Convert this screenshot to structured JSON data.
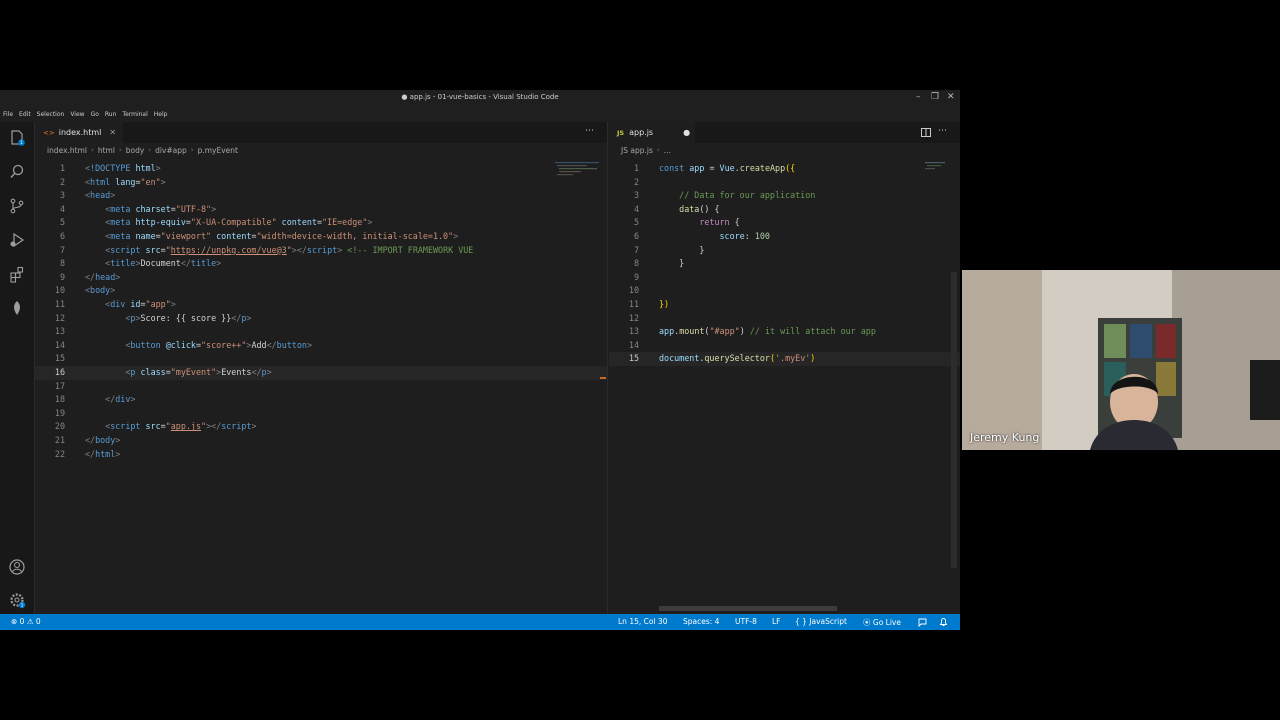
{
  "window": {
    "title": "● app.js - 01-vue-basics - Visual Studio Code",
    "controls": [
      "–",
      "❐",
      "✕"
    ]
  },
  "menu": [
    "File",
    "Edit",
    "Selection",
    "View",
    "Go",
    "Run",
    "Terminal",
    "Help"
  ],
  "activity_icons": [
    "explorer-icon",
    "search-icon",
    "source-control-icon",
    "run-debug-icon",
    "extensions-icon",
    "live-share-icon",
    "account-icon",
    "settings-gear-icon"
  ],
  "activity_badges": {
    "explorer": "1",
    "settings": "1"
  },
  "left_editor": {
    "tab": {
      "icon": "<>",
      "label": "index.html",
      "close": "✕"
    },
    "breadcrumb": [
      "index.html",
      "html",
      "body",
      "div#app",
      "p.myEvent"
    ],
    "active_line": 16,
    "lines": [
      {
        "n": "1",
        "parts": [
          [
            "t-pun",
            "<"
          ],
          [
            "t-tag",
            "!DOCTYPE "
          ],
          [
            "t-attr",
            "html"
          ],
          [
            "t-pun",
            ">"
          ]
        ]
      },
      {
        "n": "2",
        "parts": [
          [
            "t-pun",
            "<"
          ],
          [
            "t-tag",
            "html "
          ],
          [
            "t-attr",
            "lang"
          ],
          [
            "t-txt",
            "="
          ],
          [
            "t-str",
            "\"en\""
          ],
          [
            "t-pun",
            ">"
          ]
        ]
      },
      {
        "n": "3",
        "parts": [
          [
            "t-pun",
            "<"
          ],
          [
            "t-tag",
            "head"
          ],
          [
            "t-pun",
            ">"
          ]
        ]
      },
      {
        "n": "4",
        "parts": [
          [
            "t-txt",
            "    "
          ],
          [
            "t-pun",
            "<"
          ],
          [
            "t-tag",
            "meta "
          ],
          [
            "t-attr",
            "charset"
          ],
          [
            "t-txt",
            "="
          ],
          [
            "t-str",
            "\"UTF-8\""
          ],
          [
            "t-pun",
            ">"
          ]
        ]
      },
      {
        "n": "5",
        "parts": [
          [
            "t-txt",
            "    "
          ],
          [
            "t-pun",
            "<"
          ],
          [
            "t-tag",
            "meta "
          ],
          [
            "t-attr",
            "http-equiv"
          ],
          [
            "t-txt",
            "="
          ],
          [
            "t-str",
            "\"X-UA-Compatible\""
          ],
          [
            "t-txt",
            " "
          ],
          [
            "t-attr",
            "content"
          ],
          [
            "t-txt",
            "="
          ],
          [
            "t-str",
            "\"IE=edge\""
          ],
          [
            "t-pun",
            ">"
          ]
        ]
      },
      {
        "n": "6",
        "parts": [
          [
            "t-txt",
            "    "
          ],
          [
            "t-pun",
            "<"
          ],
          [
            "t-tag",
            "meta "
          ],
          [
            "t-attr",
            "name"
          ],
          [
            "t-txt",
            "="
          ],
          [
            "t-str",
            "\"viewport\""
          ],
          [
            "t-txt",
            " "
          ],
          [
            "t-attr",
            "content"
          ],
          [
            "t-txt",
            "="
          ],
          [
            "t-str",
            "\"width=device-width, initial-scale=1.0\""
          ],
          [
            "t-pun",
            ">"
          ]
        ]
      },
      {
        "n": "7",
        "parts": [
          [
            "t-txt",
            "    "
          ],
          [
            "t-pun",
            "<"
          ],
          [
            "t-tag",
            "script "
          ],
          [
            "t-attr",
            "src"
          ],
          [
            "t-txt",
            "="
          ],
          [
            "t-str",
            "\""
          ],
          [
            "t-url",
            "https://unpkg.com/vue@3"
          ],
          [
            "t-str",
            "\""
          ],
          [
            "t-pun",
            "></"
          ],
          [
            "t-tag",
            "script"
          ],
          [
            "t-pun",
            ">"
          ],
          [
            "t-txt",
            " "
          ],
          [
            "t-com",
            "<!-- IMPORT FRAMEWORK VUE"
          ]
        ]
      },
      {
        "n": "8",
        "parts": [
          [
            "t-txt",
            "    "
          ],
          [
            "t-pun",
            "<"
          ],
          [
            "t-tag",
            "title"
          ],
          [
            "t-pun",
            ">"
          ],
          [
            "t-txt",
            "Document"
          ],
          [
            "t-pun",
            "</"
          ],
          [
            "t-tag",
            "title"
          ],
          [
            "t-pun",
            ">"
          ]
        ]
      },
      {
        "n": "9",
        "parts": [
          [
            "t-pun",
            "</"
          ],
          [
            "t-tag",
            "head"
          ],
          [
            "t-pun",
            ">"
          ]
        ]
      },
      {
        "n": "10",
        "parts": [
          [
            "t-pun",
            "<"
          ],
          [
            "t-tag",
            "body"
          ],
          [
            "t-pun",
            ">"
          ]
        ]
      },
      {
        "n": "11",
        "parts": [
          [
            "t-txt",
            "    "
          ],
          [
            "t-pun",
            "<"
          ],
          [
            "t-tag",
            "div "
          ],
          [
            "t-attr",
            "id"
          ],
          [
            "t-txt",
            "="
          ],
          [
            "t-str",
            "\"app\""
          ],
          [
            "t-pun",
            ">"
          ]
        ]
      },
      {
        "n": "12",
        "parts": [
          [
            "t-txt",
            "        "
          ],
          [
            "t-pun",
            "<"
          ],
          [
            "t-tag",
            "p"
          ],
          [
            "t-pun",
            ">"
          ],
          [
            "t-txt",
            "Score: {{ score }}"
          ],
          [
            "t-pun",
            "</"
          ],
          [
            "t-tag",
            "p"
          ],
          [
            "t-pun",
            ">"
          ]
        ]
      },
      {
        "n": "13",
        "parts": []
      },
      {
        "n": "14",
        "parts": [
          [
            "t-txt",
            "        "
          ],
          [
            "t-pun",
            "<"
          ],
          [
            "t-tag",
            "button "
          ],
          [
            "t-attr",
            "@click"
          ],
          [
            "t-txt",
            "="
          ],
          [
            "t-str",
            "\"score++\""
          ],
          [
            "t-pun",
            ">"
          ],
          [
            "t-txt",
            "Add"
          ],
          [
            "t-pun",
            "</"
          ],
          [
            "t-tag",
            "button"
          ],
          [
            "t-pun",
            ">"
          ]
        ]
      },
      {
        "n": "15",
        "parts": []
      },
      {
        "n": "16",
        "parts": [
          [
            "t-txt",
            "        "
          ],
          [
            "t-pun",
            "<"
          ],
          [
            "t-tag",
            "p "
          ],
          [
            "t-attr",
            "class"
          ],
          [
            "t-txt",
            "="
          ],
          [
            "t-str",
            "\"myEvent\""
          ],
          [
            "t-pun",
            ">"
          ],
          [
            "t-txt",
            "Events"
          ],
          [
            "t-pun",
            "</"
          ],
          [
            "t-tag",
            "p"
          ],
          [
            "t-pun",
            ">"
          ]
        ]
      },
      {
        "n": "17",
        "parts": []
      },
      {
        "n": "18",
        "parts": [
          [
            "t-txt",
            "    "
          ],
          [
            "t-pun",
            "</"
          ],
          [
            "t-tag",
            "div"
          ],
          [
            "t-pun",
            ">"
          ]
        ]
      },
      {
        "n": "19",
        "parts": []
      },
      {
        "n": "20",
        "parts": [
          [
            "t-txt",
            "    "
          ],
          [
            "t-pun",
            "<"
          ],
          [
            "t-tag",
            "script "
          ],
          [
            "t-attr",
            "src"
          ],
          [
            "t-txt",
            "="
          ],
          [
            "t-str",
            "\""
          ],
          [
            "t-url",
            "app.js"
          ],
          [
            "t-str",
            "\""
          ],
          [
            "t-pun",
            "></"
          ],
          [
            "t-tag",
            "script"
          ],
          [
            "t-pun",
            ">"
          ]
        ]
      },
      {
        "n": "21",
        "parts": [
          [
            "t-pun",
            "</"
          ],
          [
            "t-tag",
            "body"
          ],
          [
            "t-pun",
            ">"
          ]
        ]
      },
      {
        "n": "22",
        "parts": [
          [
            "t-pun",
            "</"
          ],
          [
            "t-tag",
            "html"
          ],
          [
            "t-pun",
            ">"
          ]
        ]
      }
    ]
  },
  "right_editor": {
    "tab": {
      "icon": "JS",
      "label": "app.js",
      "dirty": "●"
    },
    "breadcrumb": [
      "JS app.js",
      "..."
    ],
    "active_line": 15,
    "lines": [
      {
        "n": "1",
        "parts": [
          [
            "t-kw",
            "const "
          ],
          [
            "t-var",
            "app"
          ],
          [
            "t-txt",
            " = "
          ],
          [
            "t-var",
            "Vue"
          ],
          [
            "t-txt",
            "."
          ],
          [
            "t-fn",
            "createApp"
          ],
          [
            "t-yel",
            "({"
          ]
        ]
      },
      {
        "n": "2",
        "parts": []
      },
      {
        "n": "3",
        "parts": [
          [
            "t-txt",
            "    "
          ],
          [
            "t-com",
            "// Data for our application"
          ]
        ]
      },
      {
        "n": "4",
        "parts": [
          [
            "t-txt",
            "    "
          ],
          [
            "t-fn",
            "data"
          ],
          [
            "t-txt",
            "() {"
          ]
        ]
      },
      {
        "n": "5",
        "parts": [
          [
            "t-txt",
            "        "
          ],
          [
            "t-ctl",
            "return"
          ],
          [
            "t-txt",
            " {"
          ]
        ]
      },
      {
        "n": "6",
        "parts": [
          [
            "t-txt",
            "            "
          ],
          [
            "t-var",
            "score"
          ],
          [
            "t-txt",
            ": "
          ],
          [
            "t-num",
            "100"
          ]
        ]
      },
      {
        "n": "7",
        "parts": [
          [
            "t-txt",
            "        }"
          ]
        ]
      },
      {
        "n": "8",
        "parts": [
          [
            "t-txt",
            "    }"
          ]
        ]
      },
      {
        "n": "9",
        "parts": []
      },
      {
        "n": "10",
        "parts": []
      },
      {
        "n": "11",
        "parts": [
          [
            "t-yel",
            "})"
          ]
        ]
      },
      {
        "n": "12",
        "parts": []
      },
      {
        "n": "13",
        "parts": [
          [
            "t-var",
            "app"
          ],
          [
            "t-txt",
            "."
          ],
          [
            "t-fn",
            "mount"
          ],
          [
            "t-txt",
            "("
          ],
          [
            "t-str",
            "\"#app\""
          ],
          [
            "t-txt",
            ") "
          ],
          [
            "t-com",
            "// it will attach our app"
          ]
        ]
      },
      {
        "n": "14",
        "parts": []
      },
      {
        "n": "15",
        "parts": [
          [
            "t-var",
            "document"
          ],
          [
            "t-txt",
            "."
          ],
          [
            "t-fn",
            "querySelector"
          ],
          [
            "t-yel",
            "("
          ],
          [
            "t-str",
            "'.myEv'"
          ],
          [
            "t-yel",
            ")"
          ]
        ]
      }
    ]
  },
  "status": {
    "problems": "⊗ 0 ⚠ 0",
    "position": "Ln 15, Col 30",
    "spaces": "Spaces: 4",
    "encoding": "UTF-8",
    "eol": "LF",
    "language": "{ } JavaScript",
    "golive": "⦿ Go Live"
  },
  "webcam": {
    "name": "Jeremy Kung"
  }
}
